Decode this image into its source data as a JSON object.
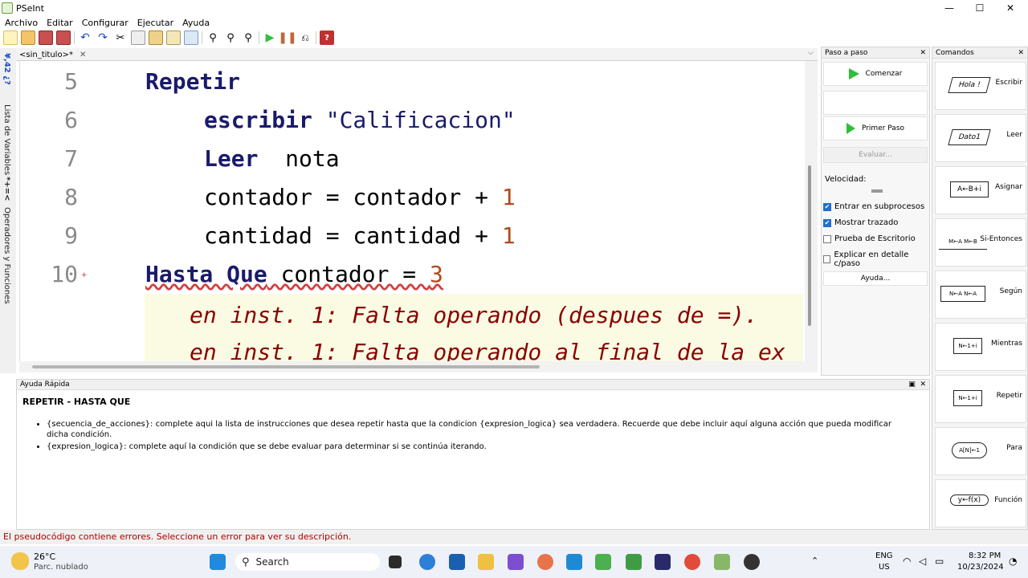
{
  "window": {
    "title": "PSeInt",
    "minimize": "—",
    "maximize": "☐",
    "close": "✕"
  },
  "menu": [
    "Archivo",
    "Editar",
    "Configurar",
    "Ejecutar",
    "Ayuda"
  ],
  "sidebar": {
    "variables": "Lista de Variables",
    "operators": "Operadores y Funciones",
    "variables_glyphs": "¥,42 ¿? ",
    "operators_glyphs": "*+=<"
  },
  "editor": {
    "tab_label": "<sin_titulo>*",
    "lines": [
      {
        "num": "5",
        "code": "Repetir"
      },
      {
        "num": "6",
        "code": "escribir \"Calificacion\""
      },
      {
        "num": "7",
        "code": "Leer  nota"
      },
      {
        "num": "8",
        "code": "contador = contador + 1"
      },
      {
        "num": "9",
        "code": "cantidad = cantidad + 1"
      },
      {
        "num": "10",
        "code": "Hasta Que contador = 3"
      }
    ],
    "errors": [
      "en inst. 1: Falta operando (despues de =).",
      "en inst. 1: Falta operando al final de la ex"
    ]
  },
  "paso": {
    "title": "Paso a paso",
    "comenzar": "Comenzar",
    "primer_paso": "Primer Paso",
    "evaluar": "Evaluar...",
    "velocidad": "Velocidad:",
    "checks": [
      {
        "label": "Entrar en subprocesos",
        "on": true
      },
      {
        "label": "Mostrar trazado",
        "on": true
      },
      {
        "label": "Prueba de Escritorio",
        "on": false
      },
      {
        "label": "Explicar en detalle c/paso",
        "on": false
      }
    ],
    "ayuda": "Ayuda..."
  },
  "comandos": {
    "title": "Comandos",
    "items": [
      {
        "label": "Escribir",
        "sym": "Hola !"
      },
      {
        "label": "Leer",
        "sym": "Dato1"
      },
      {
        "label": "Asignar",
        "sym": "A←B+i"
      },
      {
        "label": "Si-Entonces",
        "sym": "M←A  M←B"
      },
      {
        "label": "Según",
        "sym": "N←A N←A"
      },
      {
        "label": "Mientras",
        "sym": "N←1+i"
      },
      {
        "label": "Repetir",
        "sym": "N←1+i"
      },
      {
        "label": "Para",
        "sym": "A[N]←1"
      },
      {
        "label": "Función",
        "sym": "y←f(x)"
      }
    ]
  },
  "ayuda": {
    "title": "Ayuda Rápida",
    "heading": "REPETIR - HASTA QUE",
    "items": [
      "{secuencia_de_acciones}: complete aqui la lista de instrucciones que desea repetir hasta que la condicion {expresion_logica} sea verdadera. Recuerde que debe incluir aquí alguna acción que pueda modificar dicha condición.",
      "{expresion_logica}: complete aquí la condición que se debe evaluar para determinar si se continúa iterando."
    ]
  },
  "status": "El pseudocódigo contiene errores. Seleccione un error para ver su descripción.",
  "taskbar": {
    "weather_temp": "26°C",
    "weather_desc": "Parc. nublado",
    "search": "Search",
    "lang1": "ENG",
    "lang2": "US",
    "time": "8:32 PM",
    "date": "10/23/2024"
  }
}
